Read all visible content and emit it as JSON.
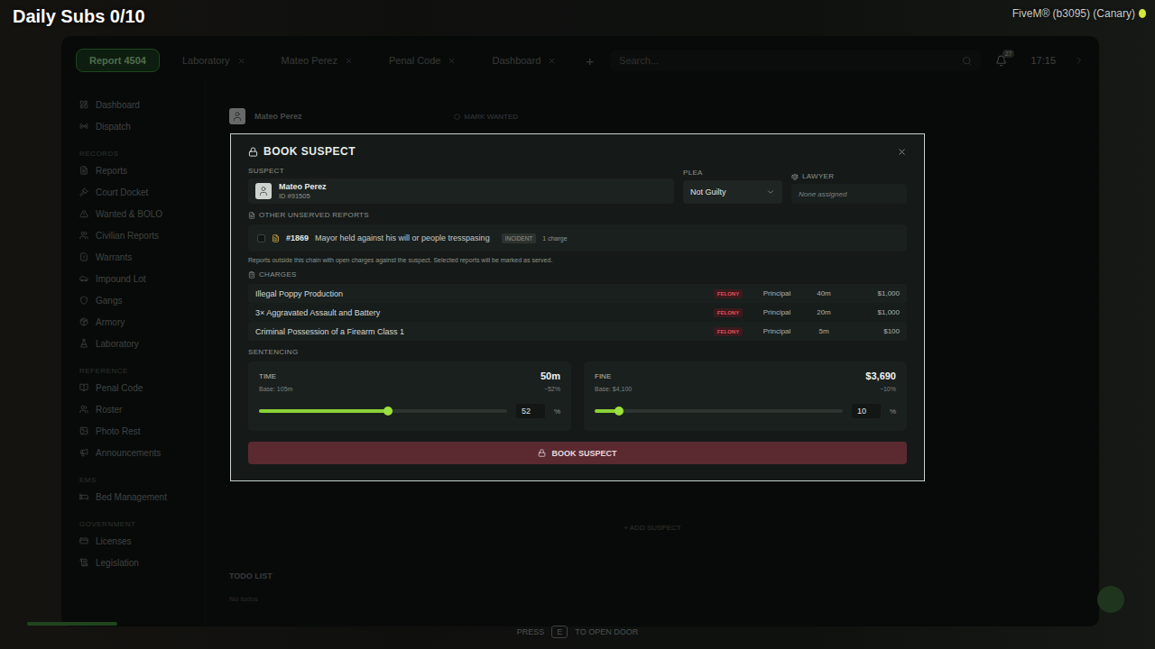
{
  "hud": {
    "daily_subs": "Daily Subs 0/10",
    "client": "FiveM® (b3095) (Canary)",
    "prompt_press": "PRESS",
    "prompt_key": "E",
    "prompt_action": "TO OPEN DOOR"
  },
  "topbar": {
    "tabs": [
      {
        "label": "Report 4504",
        "selected": true
      },
      {
        "label": "Laboratory",
        "selected": false
      },
      {
        "label": "Mateo Perez",
        "selected": false
      },
      {
        "label": "Penal Code",
        "selected": false
      },
      {
        "label": "Dashboard",
        "selected": false
      }
    ],
    "add": "+",
    "search_placeholder": "Search...",
    "notifications": "27",
    "time": "17:15"
  },
  "sidebar": {
    "top_items": [
      {
        "label": "Dashboard",
        "selected": false
      },
      {
        "label": "Dispatch",
        "selected": false
      }
    ],
    "sections": [
      {
        "title": "RECORDS",
        "items": [
          {
            "label": "Reports",
            "selected": false
          },
          {
            "label": "Court Docket",
            "selected": false
          },
          {
            "label": "Wanted & BOLO",
            "selected": false
          },
          {
            "label": "Civilian Reports",
            "selected": false
          },
          {
            "label": "Warrants",
            "selected": false
          },
          {
            "label": "Impound Lot",
            "selected": false
          },
          {
            "label": "Gangs",
            "selected": false
          },
          {
            "label": "Armory",
            "selected": false
          },
          {
            "label": "Laboratory",
            "selected": false
          }
        ]
      },
      {
        "title": "REFERENCE",
        "items": [
          {
            "label": "Penal Code",
            "selected": false
          },
          {
            "label": "Roster",
            "selected": false
          },
          {
            "label": "Photo Rest",
            "selected": false
          },
          {
            "label": "Announcements",
            "selected": false
          }
        ]
      },
      {
        "title": "EMS",
        "items": [
          {
            "label": "Bed Management",
            "selected": false
          }
        ]
      },
      {
        "title": "GOVERNMENT",
        "items": [
          {
            "label": "Licenses",
            "selected": false
          },
          {
            "label": "Legislation",
            "selected": false
          }
        ]
      }
    ]
  },
  "report": {
    "suspect_name": "Mateo Perez",
    "mark_wanted": "MARK WANTED",
    "add_suspect": "+ ADD SUSPECT",
    "todo_title": "TODO LIST",
    "todo_empty": "No todos"
  },
  "modal": {
    "title": "BOOK SUSPECT",
    "suspect_label": "SUSPECT",
    "suspect_name": "Mateo Perez",
    "suspect_id": "ID #91505",
    "plea_label": "PLEA",
    "plea": "Not Guilty",
    "lawyer_label": "LAWYER",
    "lawyer": "None assigned",
    "unserved_label": "OTHER UNSERVED REPORTS",
    "unserved": [
      {
        "number": "#1869",
        "title": "Mayor held against his will or people tresspasing",
        "type": "INCIDENT",
        "charges": "1 charge",
        "selected": false
      }
    ],
    "unserved_note": "Reports outside this chain with open charges against the suspect. Selected reports will be marked as served.",
    "charges_label": "CHARGES",
    "charges": [
      {
        "name": "Illegal Poppy Production",
        "class": "FELONY",
        "role": "Principal",
        "time": "40m",
        "fine": "$1,000"
      },
      {
        "name": "3× Aggravated Assault and Battery",
        "class": "FELONY",
        "role": "Principal",
        "time": "20m",
        "fine": "$1,000"
      },
      {
        "name": "Criminal Possession of a Firearm Class 1",
        "class": "FELONY",
        "role": "Principal",
        "time": "5m",
        "fine": "$100"
      }
    ],
    "sentencing_label": "SENTENCING",
    "sentencing": [
      {
        "title": "TIME",
        "value": "50m",
        "base": "Base: 105m",
        "change": "−52%",
        "level": 0.52,
        "input": "52",
        "unit": "%"
      },
      {
        "title": "FINE",
        "value": "$3,690",
        "base": "Base: $4,100",
        "change": "−10%",
        "level": 0.1,
        "input": "10",
        "unit": "%"
      }
    ],
    "button": "BOOK SUSPECT"
  }
}
